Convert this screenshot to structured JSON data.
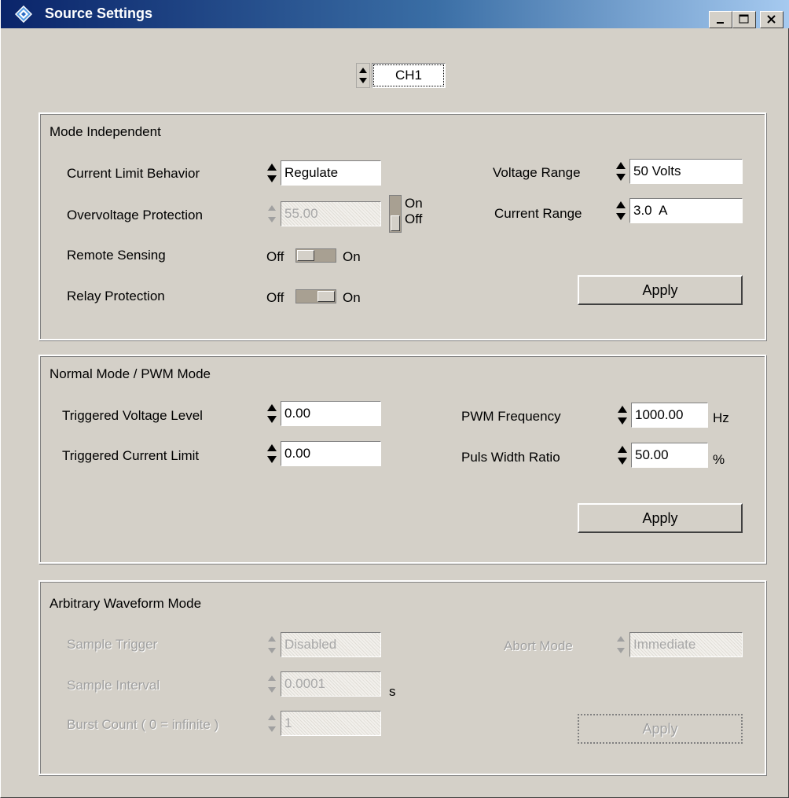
{
  "window": {
    "title": "Source Settings"
  },
  "channel": {
    "value": "CH1"
  },
  "mode_independent": {
    "title": "Mode Independent",
    "current_limit_behavior": {
      "label": "Current Limit Behavior",
      "value": "Regulate"
    },
    "overvoltage_protection": {
      "label": "Overvoltage Protection",
      "value": "55.00",
      "toggle_on": "On",
      "toggle_off": "Off"
    },
    "remote_sensing": {
      "label": "Remote Sensing",
      "off": "Off",
      "on": "On"
    },
    "relay_protection": {
      "label": "Relay Protection",
      "off": "Off",
      "on": "On"
    },
    "voltage_range": {
      "label": "Voltage Range",
      "value": "50 Volts"
    },
    "current_range": {
      "label": "Current Range",
      "value": "3.0  A"
    },
    "apply_label": "Apply"
  },
  "normal_pwm": {
    "title": "Normal Mode / PWM Mode",
    "triggered_voltage": {
      "label": "Triggered Voltage Level",
      "value": "0.00"
    },
    "triggered_current": {
      "label": "Triggered Current Limit",
      "value": "0.00"
    },
    "pwm_frequency": {
      "label": "PWM Frequency",
      "value": "1000.00",
      "unit": "Hz"
    },
    "puls_width_ratio": {
      "label": "Puls Width Ratio",
      "value": "50.00",
      "unit": "%"
    },
    "apply_label": "Apply"
  },
  "arbitrary": {
    "title": "Arbitrary Waveform Mode",
    "sample_trigger": {
      "label": "Sample Trigger",
      "value": "Disabled"
    },
    "sample_interval": {
      "label": "Sample Interval",
      "value": "0.0001",
      "unit": "s"
    },
    "burst_count": {
      "label": "Burst Count ( 0 = infinite )",
      "value": "1"
    },
    "abort_mode": {
      "label": "Abort Mode",
      "value": "Immediate"
    },
    "apply_label": "Apply"
  }
}
